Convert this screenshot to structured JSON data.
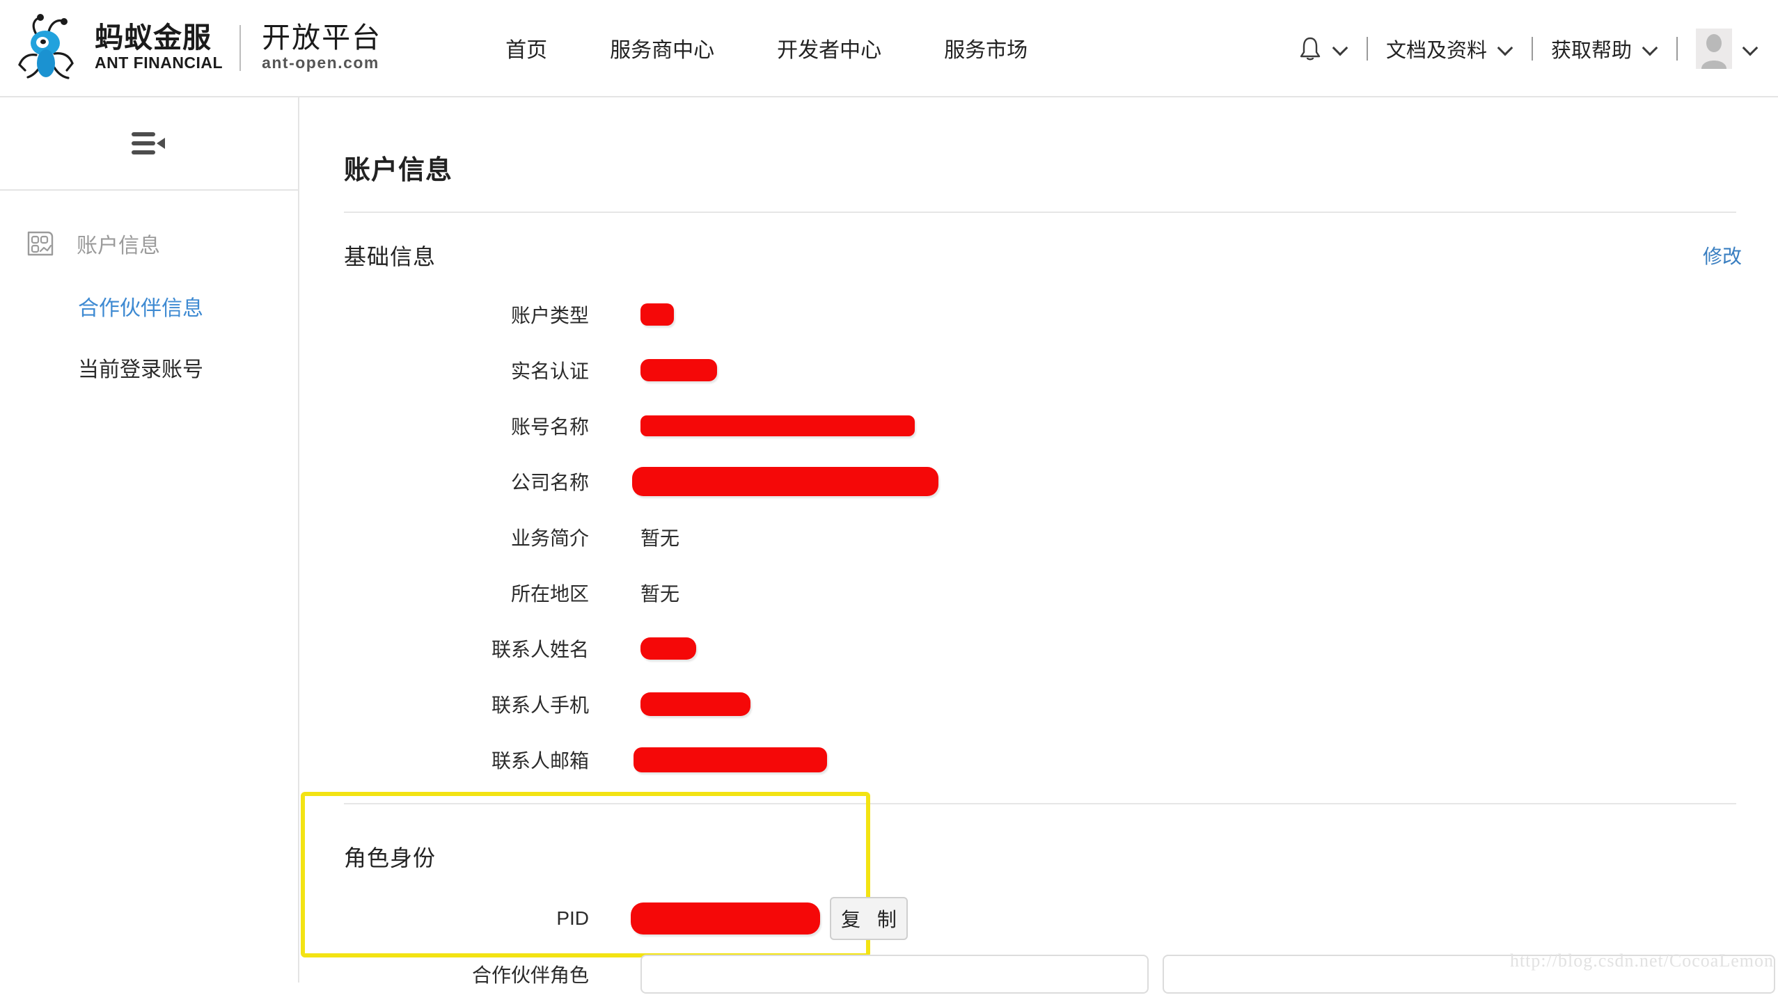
{
  "header": {
    "brand": {
      "logo_icon": "ant-financial-ant-icon",
      "cn_name": "蚂蚁金服",
      "en_name": "ANT FINANCIAL",
      "platform_cn": "开放平台",
      "platform_url": "ant-open.com"
    },
    "nav": [
      {
        "label": "首页"
      },
      {
        "label": "服务商中心"
      },
      {
        "label": "开发者中心"
      },
      {
        "label": "服务市场"
      }
    ],
    "right": {
      "bell_icon": "bell-icon",
      "docs_label": "文档及资料",
      "help_label": "获取帮助",
      "avatar_icon": "avatar-icon",
      "chevron_icon": "chevron-down-icon",
      "separator": "|"
    }
  },
  "sidebar": {
    "collapse_icon": "collapse-menu-icon",
    "group": {
      "icon": "account-card-icon",
      "label": "账户信息"
    },
    "items": [
      {
        "label": "合作伙伴信息",
        "active": true
      },
      {
        "label": "当前登录账号",
        "active": false
      }
    ]
  },
  "main": {
    "page_title": "账户信息",
    "basic_section": {
      "title": "基础信息",
      "edit_label": "修改",
      "rows": [
        {
          "label": "账户类型",
          "value": "",
          "redacted": true
        },
        {
          "label": "实名认证",
          "value": "",
          "redacted": true
        },
        {
          "label": "账号名称",
          "value": "",
          "redacted": true
        },
        {
          "label": "公司名称",
          "value": "",
          "redacted": true
        },
        {
          "label": "业务简介",
          "value": "暂无",
          "redacted": false
        },
        {
          "label": "所在地区",
          "value": "暂无",
          "redacted": false
        },
        {
          "label": "联系人姓名",
          "value": "",
          "redacted": true
        },
        {
          "label": "联系人手机",
          "value": "",
          "redacted": true
        },
        {
          "label": "联系人邮箱",
          "value": "",
          "redacted": true
        }
      ]
    },
    "role_section": {
      "title": "角色身份",
      "highlighted": true,
      "highlight_color": "#f3e313",
      "pid": {
        "label": "PID",
        "value": "",
        "redacted": true,
        "copy_label": "复 制"
      },
      "partner_role": {
        "label": "合作伙伴角色",
        "input_value": "",
        "input_value_2": ""
      }
    }
  },
  "watermark": "http://blog.csdn.net/CocoaLemon",
  "colors": {
    "accent_blue": "#3e8ad2",
    "link_blue": "#3a7fc1",
    "redaction_red": "#f50808",
    "highlight_yellow": "#f3e313"
  }
}
